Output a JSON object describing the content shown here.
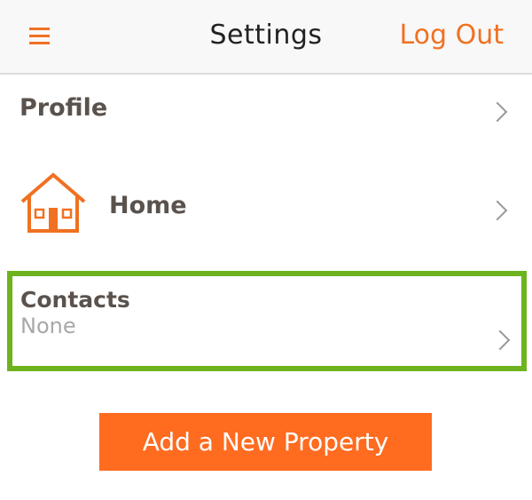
{
  "header": {
    "title": "Settings",
    "logout_label": "Log Out",
    "menu_icon": "hamburger-menu-icon"
  },
  "rows": {
    "profile": {
      "label": "Profile"
    },
    "home": {
      "label": "Home",
      "icon": "house-icon"
    },
    "contacts": {
      "label": "Contacts",
      "value": "None"
    }
  },
  "actions": {
    "add_property_label": "Add a New Property"
  },
  "colors": {
    "accent": "#f07122",
    "button": "#ff6b1f",
    "highlight": "#6db31e",
    "label": "#5a524d",
    "muted": "#a8a8a8"
  }
}
